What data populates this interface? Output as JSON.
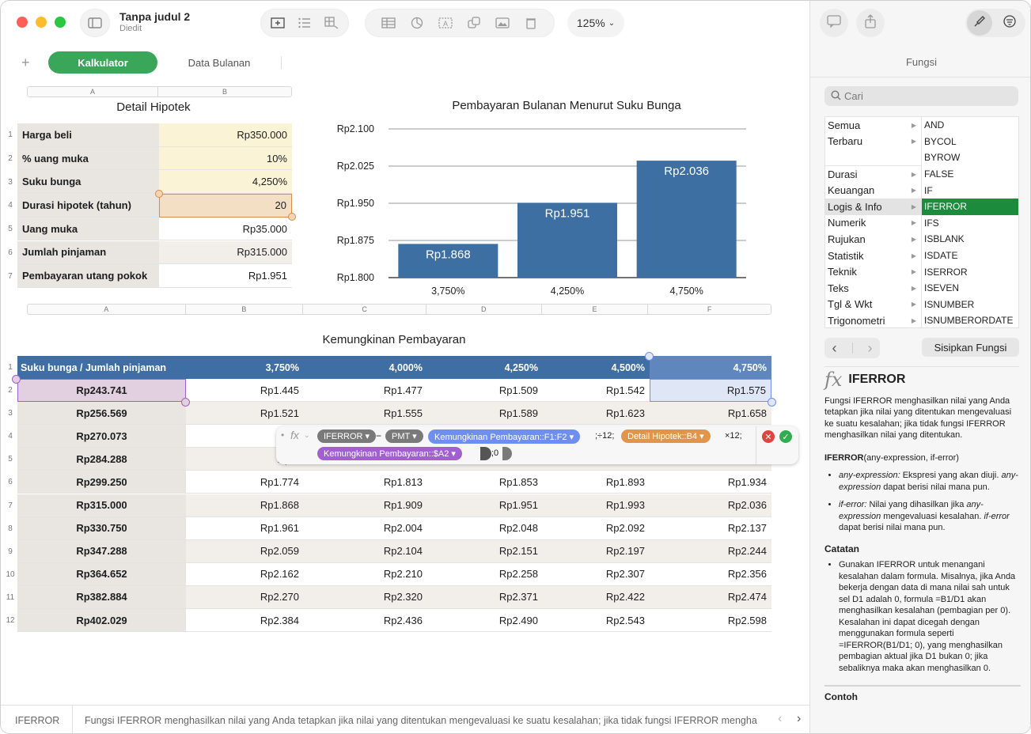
{
  "toolbar": {
    "doc_title": "Tanpa judul 2",
    "doc_subtitle": "Diedit",
    "zoom": "125%"
  },
  "sheets": {
    "add_label": "+",
    "active": "Kalkulator",
    "other": "Data Bulanan"
  },
  "mortgage": {
    "title": "Detail Hipotek",
    "columns": [
      "A",
      "B"
    ],
    "rows": [
      {
        "n": "1",
        "label": "Harga beli",
        "value": "Rp350.000"
      },
      {
        "n": "2",
        "label": "% uang muka",
        "value": "10%"
      },
      {
        "n": "3",
        "label": "Suku bunga",
        "value": "4,250%"
      },
      {
        "n": "4",
        "label": "Durasi hipotek (tahun)",
        "value": "20"
      },
      {
        "n": "5",
        "label": "Uang muka",
        "value": "Rp35.000"
      },
      {
        "n": "6",
        "label": "Jumlah pinjaman",
        "value": "Rp315.000"
      },
      {
        "n": "7",
        "label": "Pembayaran utang pokok",
        "value": "Rp1.951"
      }
    ]
  },
  "chart_data": {
    "type": "bar",
    "title": "Pembayaran Bulanan Menurut Suku Bunga",
    "categories": [
      "3,750%",
      "4,250%",
      "4,750%"
    ],
    "values": [
      1868,
      1951,
      2036
    ],
    "data_labels": [
      "Rp1.868",
      "Rp1.951",
      "Rp2.036"
    ],
    "ylim": [
      1800,
      2100
    ],
    "yticks": [
      "Rp2.100",
      "Rp2.025",
      "Rp1.950",
      "Rp1.875",
      "Rp1.800"
    ],
    "ytick_values": [
      2100,
      2025,
      1950,
      1875,
      1800
    ],
    "bar_color": "#3d6fa3",
    "grid": true
  },
  "payments": {
    "title": "Kemungkinan Pembayaran",
    "columns": [
      "A",
      "B",
      "C",
      "D",
      "E",
      "F"
    ],
    "header": [
      "Suku bunga / Jumlah pinjaman",
      "3,750%",
      "4,000%",
      "4,250%",
      "4,500%",
      "4,750%"
    ],
    "rows": [
      {
        "n": "2",
        "cells": [
          "Rp243.741",
          "Rp1.445",
          "Rp1.477",
          "Rp1.509",
          "Rp1.542",
          "Rp1.575"
        ]
      },
      {
        "n": "3",
        "cells": [
          "Rp256.569",
          "Rp1.521",
          "Rp1.555",
          "Rp1.589",
          "Rp1.623",
          "Rp1.658"
        ]
      },
      {
        "n": "4",
        "cells": [
          "Rp270.073",
          "Rp1",
          "",
          "",
          "",
          ""
        ]
      },
      {
        "n": "5",
        "cells": [
          "Rp284.288",
          "Rp1.",
          "",
          "",
          "",
          ""
        ]
      },
      {
        "n": "6",
        "cells": [
          "Rp299.250",
          "Rp1.774",
          "Rp1.813",
          "Rp1.853",
          "Rp1.893",
          "Rp1.934"
        ]
      },
      {
        "n": "7",
        "cells": [
          "Rp315.000",
          "Rp1.868",
          "Rp1.909",
          "Rp1.951",
          "Rp1.993",
          "Rp2.036"
        ]
      },
      {
        "n": "8",
        "cells": [
          "Rp330.750",
          "Rp1.961",
          "Rp2.004",
          "Rp2.048",
          "Rp2.092",
          "Rp2.137"
        ]
      },
      {
        "n": "9",
        "cells": [
          "Rp347.288",
          "Rp2.059",
          "Rp2.104",
          "Rp2.151",
          "Rp2.197",
          "Rp2.244"
        ]
      },
      {
        "n": "10",
        "cells": [
          "Rp364.652",
          "Rp2.162",
          "Rp2.210",
          "Rp2.258",
          "Rp2.307",
          "Rp2.356"
        ]
      },
      {
        "n": "11",
        "cells": [
          "Rp382.884",
          "Rp2.270",
          "Rp2.320",
          "Rp2.371",
          "Rp2.422",
          "Rp2.474"
        ]
      },
      {
        "n": "12",
        "cells": [
          "Rp402.029",
          "Rp2.384",
          "Rp2.436",
          "Rp2.490",
          "Rp2.543",
          "Rp2.598"
        ]
      }
    ]
  },
  "formula": {
    "fx": "fx",
    "fn1": "IFERROR ▾",
    "minus": "−",
    "fn2": "PMT ▾",
    "ref1": "Kemungkinan Pembayaran::F1:F2 ▾",
    "sep1": ";÷12;",
    "ref2": "Detail Hipotek::B4 ▾",
    "sep2": "×12;",
    "ref3": "Kemungkinan Pembayaran::$A2 ▾",
    "tail": ";0",
    "colors": {
      "fn": "#7a7a7a",
      "ref1": "#6f8ff0",
      "ref2": "#e0954a",
      "ref3": "#a25fd1"
    }
  },
  "sidebar": {
    "title": "Fungsi",
    "search_placeholder": "Cari",
    "categories": [
      "Semua",
      "Terbaru",
      "",
      "Durasi",
      "Keuangan",
      "Logis & Info",
      "Numerik",
      "Rujukan",
      "Statistik",
      "Teknik",
      "Teks",
      "Tgl & Wkt",
      "Trigonometri"
    ],
    "functions": [
      "AND",
      "BYCOL",
      "BYROW",
      "FALSE",
      "IF",
      "IFERROR",
      "IFS",
      "ISBLANK",
      "ISDATE",
      "ISERROR",
      "ISEVEN",
      "ISNUMBER",
      "ISNUMBERORDATE"
    ],
    "nav_back": "‹",
    "nav_fwd": "›",
    "insert_label": "Sisipkan Fungsi",
    "help": {
      "fx": "fx",
      "name": "IFERROR",
      "desc": "Fungsi IFERROR menghasilkan nilai yang Anda tetapkan jika nilai yang ditentukan mengevaluasi ke suatu kesalahan; jika tidak fungsi IFERROR menghasilkan nilai yang ditentukan.",
      "syntax_fn": "IFERROR",
      "syntax_args": "(any-expression, if-error)",
      "arg1_name": "any-expression:",
      "arg1_desc": " Ekspresi yang akan diuji. ",
      "arg1_name2": "any-expression",
      "arg1_desc2": " dapat berisi nilai mana pun.",
      "arg2_name": "if-error:",
      "arg2_desc": " Nilai yang dihasilkan jika ",
      "arg2_name2": "any-expression",
      "arg2_desc2": " mengevaluasi kesalahan. ",
      "arg2_name3": "if-error",
      "arg2_desc3": " dapat berisi nilai mana pun.",
      "notes_title": "Catatan",
      "note1": "Gunakan IFERROR untuk menangani kesalahan dalam formula. Misalnya, jika Anda bekerja dengan data di mana nilai sah untuk sel D1 adalah 0, formula =B1/D1 akan menghasilkan kesalahan (pembagian per 0). Kesalahan ini dapat dicegah dengan menggunakan formula seperti =IFERROR(B1/D1; 0), yang menghasilkan pembagian aktual jika D1 bukan 0; jika sebaliknya maka akan menghasilkan 0.",
      "examples_title": "Contoh"
    }
  },
  "status": {
    "fn": "IFERROR",
    "text": "Fungsi IFERROR menghasilkan nilai yang Anda tetapkan jika nilai yang ditentukan mengevaluasi ke suatu kesalahan; jika tidak fungsi IFERROR mengha"
  }
}
